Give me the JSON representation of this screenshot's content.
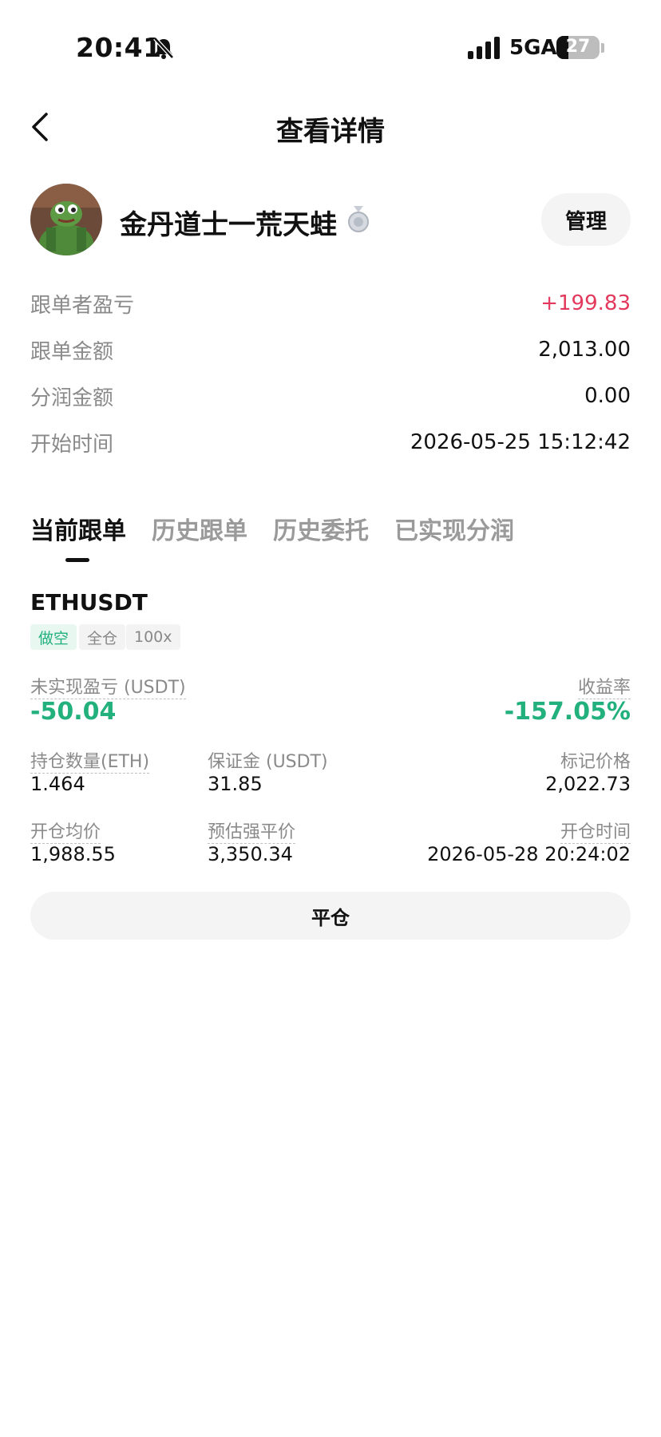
{
  "status_bar": {
    "time": "20:41",
    "network": "5GA",
    "battery": "27",
    "icons": [
      "bell-muted-icon",
      "signal-icon",
      "battery-icon"
    ]
  },
  "header": {
    "title": "查看详情",
    "back_icon": "chevron-left-icon"
  },
  "trader": {
    "name": "金丹道士一荒天蛙",
    "badge_icon": "silver-medal-icon",
    "manage_label": "管理"
  },
  "summary": [
    {
      "label": "跟单者盈亏",
      "value": "+199.83"
    },
    {
      "label": "跟单金额",
      "value": "2,013.00"
    },
    {
      "label": "分润金额",
      "value": "0.00"
    },
    {
      "label": "开始时间",
      "value": "2026-05-25 15:12:42"
    }
  ],
  "tabs": [
    "当前跟单",
    "历史跟单",
    "历史委托",
    "已实现分润"
  ],
  "position": {
    "symbol": "ETHUSDT",
    "tags": [
      "做空",
      "全仓",
      "100x"
    ],
    "pnl_label": "未实现盈亏 (USDT)",
    "pnl_value": "-50.04",
    "roi_label": "收益率",
    "roi_value": "-157.05%",
    "qty_label": "持仓数量(ETH)",
    "qty_value": "1.464",
    "margin_label": "保证金 (USDT)",
    "margin_value": "31.85",
    "mark_label": "标记价格",
    "mark_value": "2,022.73",
    "entry_label": "开仓均价",
    "entry_value": "1,988.55",
    "liq_label": "预估强平价",
    "liq_value": "3,350.34",
    "open_time_label": "开仓时间",
    "open_time_value": "2026-05-28 20:24:02",
    "close_label": "平仓"
  },
  "colors": {
    "profit": "#e2395c",
    "loss": "#22b07d",
    "muted": "#8a8a8a"
  }
}
